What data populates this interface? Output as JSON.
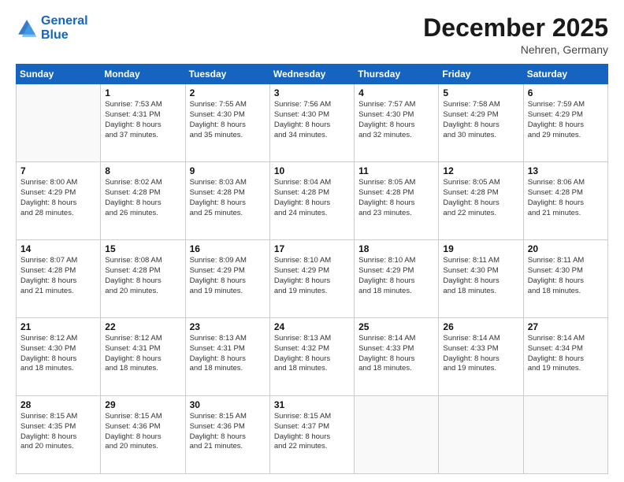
{
  "header": {
    "logo_line1": "General",
    "logo_line2": "Blue",
    "month": "December 2025",
    "location": "Nehren, Germany"
  },
  "weekdays": [
    "Sunday",
    "Monday",
    "Tuesday",
    "Wednesday",
    "Thursday",
    "Friday",
    "Saturday"
  ],
  "weeks": [
    [
      {
        "day": "",
        "info": ""
      },
      {
        "day": "1",
        "info": "Sunrise: 7:53 AM\nSunset: 4:31 PM\nDaylight: 8 hours\nand 37 minutes."
      },
      {
        "day": "2",
        "info": "Sunrise: 7:55 AM\nSunset: 4:30 PM\nDaylight: 8 hours\nand 35 minutes."
      },
      {
        "day": "3",
        "info": "Sunrise: 7:56 AM\nSunset: 4:30 PM\nDaylight: 8 hours\nand 34 minutes."
      },
      {
        "day": "4",
        "info": "Sunrise: 7:57 AM\nSunset: 4:30 PM\nDaylight: 8 hours\nand 32 minutes."
      },
      {
        "day": "5",
        "info": "Sunrise: 7:58 AM\nSunset: 4:29 PM\nDaylight: 8 hours\nand 30 minutes."
      },
      {
        "day": "6",
        "info": "Sunrise: 7:59 AM\nSunset: 4:29 PM\nDaylight: 8 hours\nand 29 minutes."
      }
    ],
    [
      {
        "day": "7",
        "info": "Sunrise: 8:00 AM\nSunset: 4:29 PM\nDaylight: 8 hours\nand 28 minutes."
      },
      {
        "day": "8",
        "info": "Sunrise: 8:02 AM\nSunset: 4:28 PM\nDaylight: 8 hours\nand 26 minutes."
      },
      {
        "day": "9",
        "info": "Sunrise: 8:03 AM\nSunset: 4:28 PM\nDaylight: 8 hours\nand 25 minutes."
      },
      {
        "day": "10",
        "info": "Sunrise: 8:04 AM\nSunset: 4:28 PM\nDaylight: 8 hours\nand 24 minutes."
      },
      {
        "day": "11",
        "info": "Sunrise: 8:05 AM\nSunset: 4:28 PM\nDaylight: 8 hours\nand 23 minutes."
      },
      {
        "day": "12",
        "info": "Sunrise: 8:05 AM\nSunset: 4:28 PM\nDaylight: 8 hours\nand 22 minutes."
      },
      {
        "day": "13",
        "info": "Sunrise: 8:06 AM\nSunset: 4:28 PM\nDaylight: 8 hours\nand 21 minutes."
      }
    ],
    [
      {
        "day": "14",
        "info": "Sunrise: 8:07 AM\nSunset: 4:28 PM\nDaylight: 8 hours\nand 21 minutes."
      },
      {
        "day": "15",
        "info": "Sunrise: 8:08 AM\nSunset: 4:28 PM\nDaylight: 8 hours\nand 20 minutes."
      },
      {
        "day": "16",
        "info": "Sunrise: 8:09 AM\nSunset: 4:29 PM\nDaylight: 8 hours\nand 19 minutes."
      },
      {
        "day": "17",
        "info": "Sunrise: 8:10 AM\nSunset: 4:29 PM\nDaylight: 8 hours\nand 19 minutes."
      },
      {
        "day": "18",
        "info": "Sunrise: 8:10 AM\nSunset: 4:29 PM\nDaylight: 8 hours\nand 18 minutes."
      },
      {
        "day": "19",
        "info": "Sunrise: 8:11 AM\nSunset: 4:30 PM\nDaylight: 8 hours\nand 18 minutes."
      },
      {
        "day": "20",
        "info": "Sunrise: 8:11 AM\nSunset: 4:30 PM\nDaylight: 8 hours\nand 18 minutes."
      }
    ],
    [
      {
        "day": "21",
        "info": "Sunrise: 8:12 AM\nSunset: 4:30 PM\nDaylight: 8 hours\nand 18 minutes."
      },
      {
        "day": "22",
        "info": "Sunrise: 8:12 AM\nSunset: 4:31 PM\nDaylight: 8 hours\nand 18 minutes."
      },
      {
        "day": "23",
        "info": "Sunrise: 8:13 AM\nSunset: 4:31 PM\nDaylight: 8 hours\nand 18 minutes."
      },
      {
        "day": "24",
        "info": "Sunrise: 8:13 AM\nSunset: 4:32 PM\nDaylight: 8 hours\nand 18 minutes."
      },
      {
        "day": "25",
        "info": "Sunrise: 8:14 AM\nSunset: 4:33 PM\nDaylight: 8 hours\nand 18 minutes."
      },
      {
        "day": "26",
        "info": "Sunrise: 8:14 AM\nSunset: 4:33 PM\nDaylight: 8 hours\nand 19 minutes."
      },
      {
        "day": "27",
        "info": "Sunrise: 8:14 AM\nSunset: 4:34 PM\nDaylight: 8 hours\nand 19 minutes."
      }
    ],
    [
      {
        "day": "28",
        "info": "Sunrise: 8:15 AM\nSunset: 4:35 PM\nDaylight: 8 hours\nand 20 minutes."
      },
      {
        "day": "29",
        "info": "Sunrise: 8:15 AM\nSunset: 4:36 PM\nDaylight: 8 hours\nand 20 minutes."
      },
      {
        "day": "30",
        "info": "Sunrise: 8:15 AM\nSunset: 4:36 PM\nDaylight: 8 hours\nand 21 minutes."
      },
      {
        "day": "31",
        "info": "Sunrise: 8:15 AM\nSunset: 4:37 PM\nDaylight: 8 hours\nand 22 minutes."
      },
      {
        "day": "",
        "info": ""
      },
      {
        "day": "",
        "info": ""
      },
      {
        "day": "",
        "info": ""
      }
    ]
  ]
}
